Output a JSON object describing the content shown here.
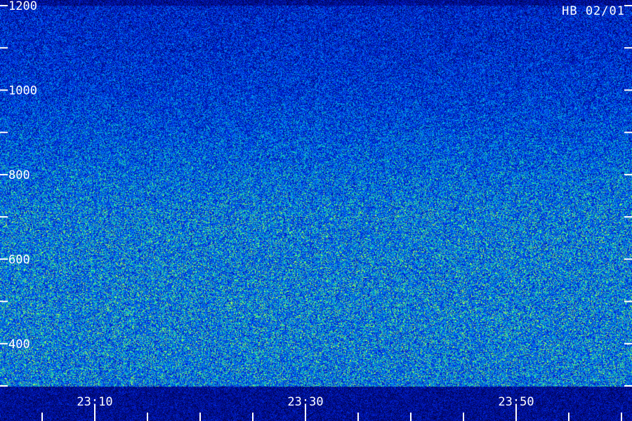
{
  "station_label": "HB 02/01",
  "chart_data": {
    "type": "heatmap",
    "title": "",
    "xlabel": "",
    "ylabel": "",
    "x_axis": {
      "range": [
        "23:01",
        "24:01"
      ],
      "tick_labels": [
        "23:10",
        "23:30",
        "23:50"
      ],
      "major_ticks": [
        "23:10",
        "23:30",
        "23:50"
      ],
      "minor_tick_step_minutes": 5
    },
    "y_axis": {
      "range": [
        300,
        1200
      ],
      "tick_labels": [
        "1200",
        "1000",
        "800",
        "600",
        "400"
      ],
      "tick_values": [
        1200,
        1000,
        800,
        600,
        400
      ],
      "minor_tick_values": [
        1100,
        900,
        700,
        500,
        300
      ]
    },
    "colormap": [
      "#00003a",
      "#0018c8",
      "#0060ff",
      "#00b0d8",
      "#30e890",
      "#c8ff40"
    ],
    "intensity_profile": {
      "y_values": [
        1200,
        1100,
        1000,
        900,
        800,
        700,
        600,
        500,
        400,
        300
      ],
      "relative_intensity": [
        0.3,
        0.33,
        0.38,
        0.46,
        0.55,
        0.62,
        0.63,
        0.64,
        0.64,
        0.62
      ]
    },
    "grid": false,
    "legend": "none"
  }
}
